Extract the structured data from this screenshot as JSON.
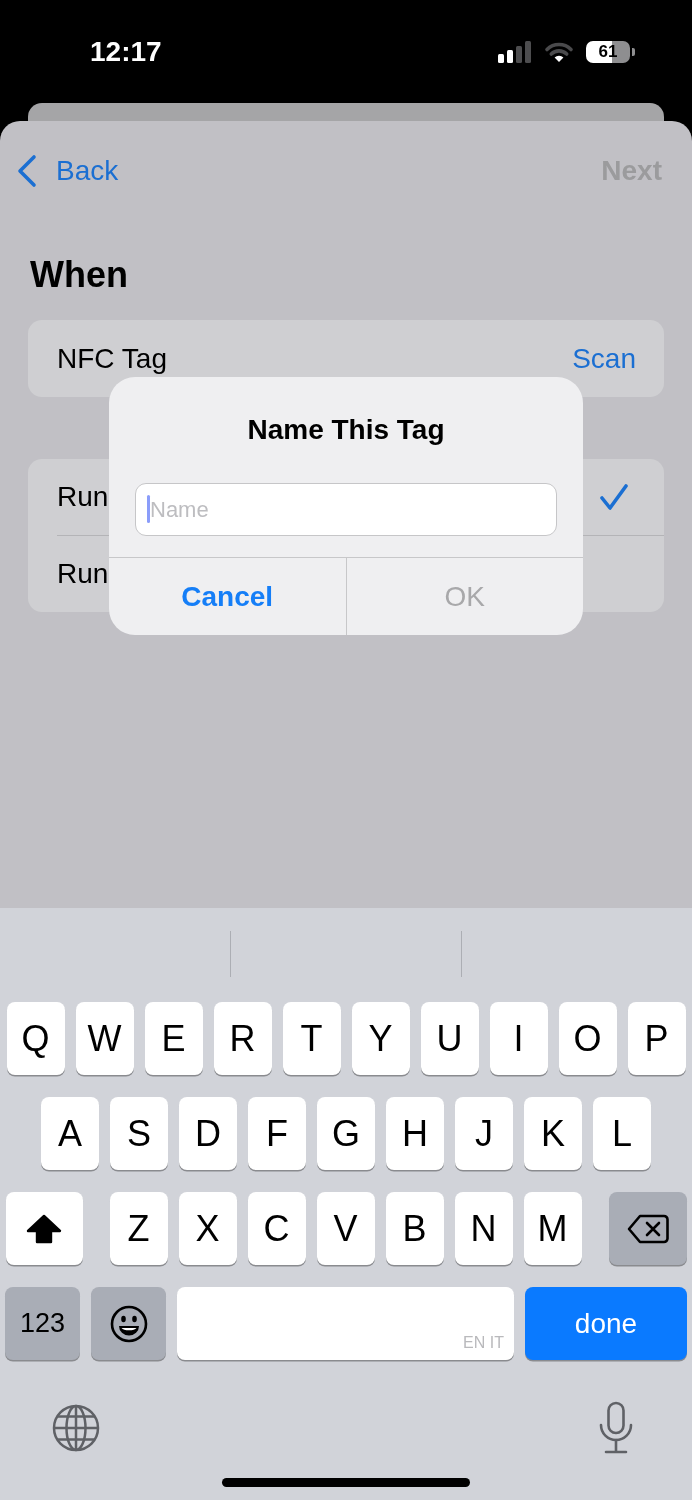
{
  "status_bar": {
    "time": "12:17",
    "battery": "61"
  },
  "nav": {
    "back": "Back",
    "next": {
      "label": "Next",
      "disabled": true
    }
  },
  "section_title": "When",
  "trigger": {
    "label": "NFC Tag",
    "action": "Scan"
  },
  "run_options": [
    {
      "label": "Run",
      "selected": true
    },
    {
      "label": "Run",
      "selected": false
    }
  ],
  "alert": {
    "title": "Name This Tag",
    "field": {
      "placeholder": "Name"
    },
    "buttons": [
      {
        "label": "Cancel",
        "kind": "cancel",
        "disabled": false
      },
      {
        "label": "OK",
        "kind": "default",
        "disabled": true
      }
    ]
  },
  "keyboard": {
    "rows": [
      {
        "keys": [
          {
            "kind": "letter",
            "label": "Q"
          },
          {
            "kind": "letter",
            "label": "W"
          },
          {
            "kind": "letter",
            "label": "E"
          },
          {
            "kind": "letter",
            "label": "R"
          },
          {
            "kind": "letter",
            "label": "T"
          },
          {
            "kind": "letter",
            "label": "Y"
          },
          {
            "kind": "letter",
            "label": "U"
          },
          {
            "kind": "letter",
            "label": "I"
          },
          {
            "kind": "letter",
            "label": "O"
          },
          {
            "kind": "letter",
            "label": "P"
          }
        ]
      },
      {
        "keys": [
          {
            "kind": "letter",
            "label": "A"
          },
          {
            "kind": "letter",
            "label": "S"
          },
          {
            "kind": "letter",
            "label": "D"
          },
          {
            "kind": "letter",
            "label": "F"
          },
          {
            "kind": "letter",
            "label": "G"
          },
          {
            "kind": "letter",
            "label": "H"
          },
          {
            "kind": "letter",
            "label": "J"
          },
          {
            "kind": "letter",
            "label": "K"
          },
          {
            "kind": "letter",
            "label": "L"
          }
        ]
      },
      {
        "keys": [
          {
            "kind": "shift",
            "on": true
          },
          {
            "kind": "letter",
            "label": "Z"
          },
          {
            "kind": "letter",
            "label": "X"
          },
          {
            "kind": "letter",
            "label": "C"
          },
          {
            "kind": "letter",
            "label": "V"
          },
          {
            "kind": "letter",
            "label": "B"
          },
          {
            "kind": "letter",
            "label": "N"
          },
          {
            "kind": "letter",
            "label": "M"
          },
          {
            "kind": "delete"
          }
        ]
      },
      {
        "keys": [
          {
            "kind": "numbers",
            "label": "123"
          },
          {
            "kind": "emoji"
          },
          {
            "kind": "space",
            "label": "EN IT"
          },
          {
            "kind": "return",
            "label": "done"
          }
        ]
      }
    ],
    "bottom": [
      {
        "kind": "globe"
      },
      {
        "kind": "dictation"
      }
    ]
  }
}
